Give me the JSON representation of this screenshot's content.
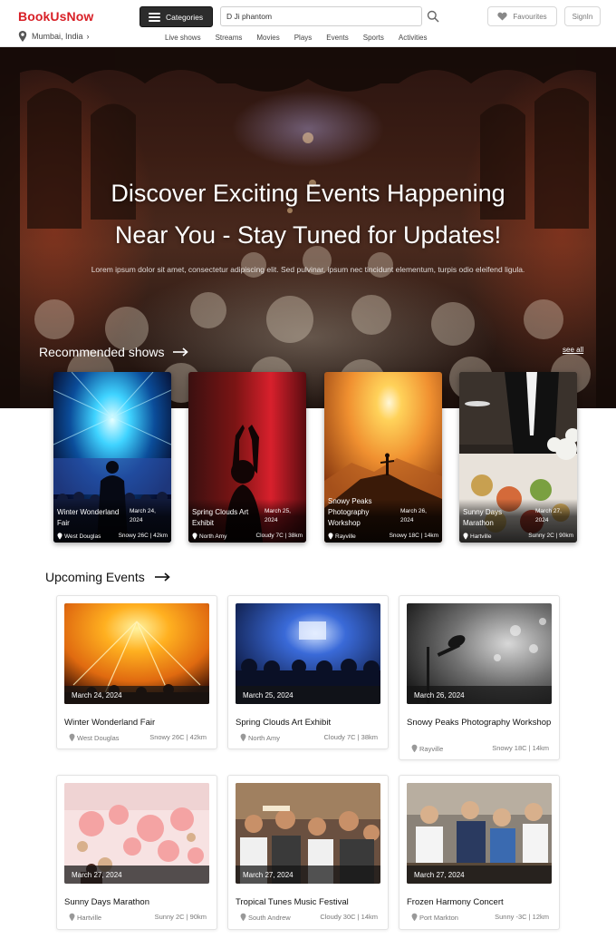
{
  "header": {
    "logo": "BookUsNow",
    "location": "Mumbai, India",
    "categories_label": "Categories",
    "search_value": "D Ji phantom",
    "favourites_label": "Favourites",
    "signin_label": "SignIn",
    "nav": [
      "Live shows",
      "Streams",
      "Movies",
      "Plays",
      "Events",
      "Sports",
      "Activities"
    ]
  },
  "hero": {
    "title_line1": "Discover Exciting Events Happening",
    "title_line2": "Near You - Stay Tuned for Updates!",
    "subtitle": "Lorem ipsum dolor sit amet, consectetur adipiscing elit. Sed pulvinar, ipsum nec tincidunt elementum, turpis odio eleifend ligula."
  },
  "recommended": {
    "title": "Recommended shows",
    "see_all": "see all",
    "cards": [
      {
        "name": "Winter Wonderland Fair",
        "date": "March 24, 2024",
        "location": "West Douglas",
        "meta": "Snowy 26C | 42km"
      },
      {
        "name": "Spring Clouds Art Exhibit",
        "date": "March 25, 2024",
        "location": "North Amy",
        "meta": "Cloudy 7C | 38km"
      },
      {
        "name": "Snowy Peaks Photography Workshop",
        "date": "March 26, 2024",
        "location": "Rayville",
        "meta": "Snowy 18C | 14km"
      },
      {
        "name": "Sunny Days Marathon",
        "date": "March 27, 2024",
        "location": "Hartville",
        "meta": "Sunny 2C | 90km"
      }
    ]
  },
  "upcoming": {
    "title": "Upcoming Events",
    "cards": [
      {
        "name": "Winter Wonderland Fair",
        "date": "March 24, 2024",
        "location": "West Douglas",
        "meta": "Snowy 26C | 42km"
      },
      {
        "name": "Spring Clouds Art Exhibit",
        "date": "March 25, 2024",
        "location": "North Amy",
        "meta": "Cloudy 7C | 38km"
      },
      {
        "name": "Snowy Peaks Photography Workshop",
        "date": "March 26, 2024",
        "location": "Rayville",
        "meta": "Snowy 18C | 14km"
      },
      {
        "name": "Sunny Days Marathon",
        "date": "March 27, 2024",
        "location": "Hartville",
        "meta": "Sunny 2C | 90km"
      },
      {
        "name": "Tropical Tunes Music Festival",
        "date": "March 27, 2024",
        "location": "South Andrew",
        "meta": "Cloudy 30C | 14km"
      },
      {
        "name": "Frozen Harmony Concert",
        "date": "March 27, 2024",
        "location": "Port Markton",
        "meta": "Sunny -3C | 12km"
      }
    ]
  },
  "colors": {
    "brand": "#d81f26",
    "dark_button": "#2c2c2c"
  }
}
